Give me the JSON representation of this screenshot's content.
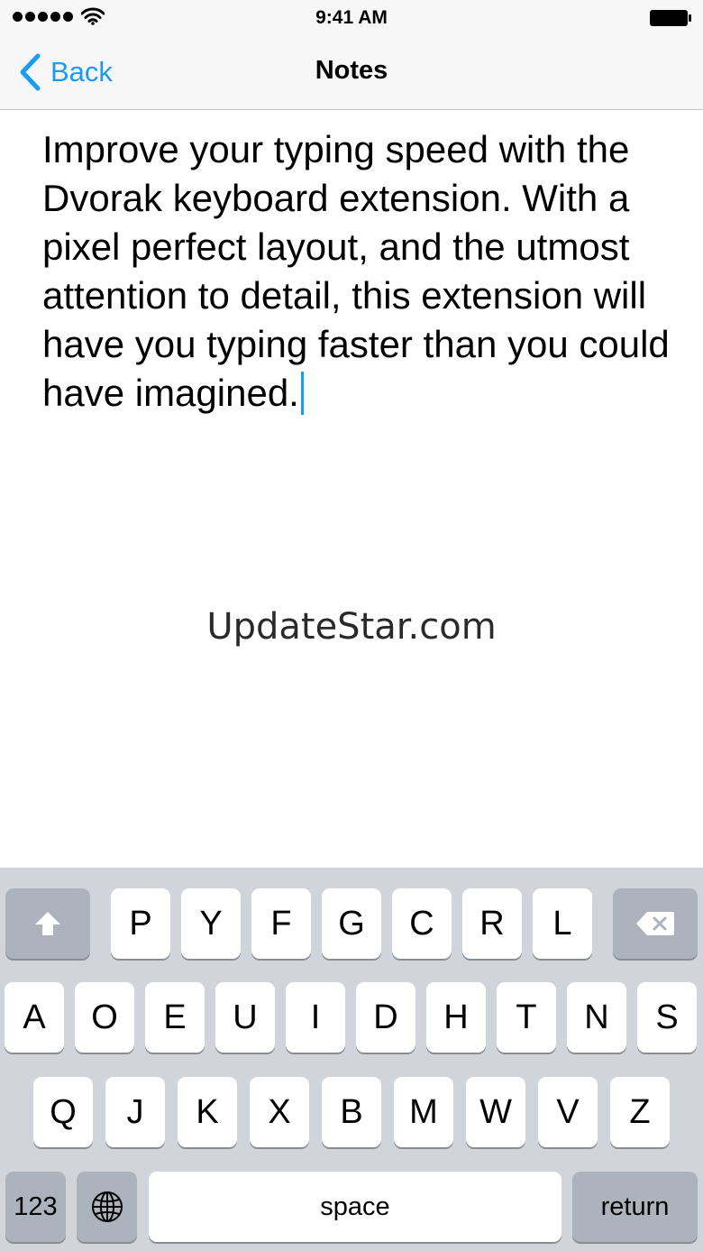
{
  "status_bar": {
    "time": "9:41 AM"
  },
  "nav": {
    "back_label": "Back",
    "title": "Notes"
  },
  "note": {
    "text": "Improve your typing speed with the Dvorak keyboard extension. With a pixel perfect layout, and the utmost attention to detail, this extension will have you typing faster than you could have imagined."
  },
  "watermark": "UpdateStar.com",
  "keyboard": {
    "row1": [
      "P",
      "Y",
      "F",
      "G",
      "C",
      "R",
      "L"
    ],
    "row2": [
      "A",
      "O",
      "E",
      "U",
      "I",
      "D",
      "H",
      "T",
      "N",
      "S"
    ],
    "row3": [
      "Q",
      "J",
      "K",
      "X",
      "B",
      "M",
      "W",
      "V",
      "Z"
    ],
    "numbers_label": "123",
    "space_label": "space",
    "return_label": "return"
  },
  "colors": {
    "accent": "#1a9cf0",
    "keyboard_bg": "#d1d5db",
    "key_dark": "#acb3bc"
  },
  "icons": [
    "wifi-icon",
    "battery-icon",
    "back-chevron-icon",
    "shift-icon",
    "delete-icon",
    "globe-icon"
  ]
}
